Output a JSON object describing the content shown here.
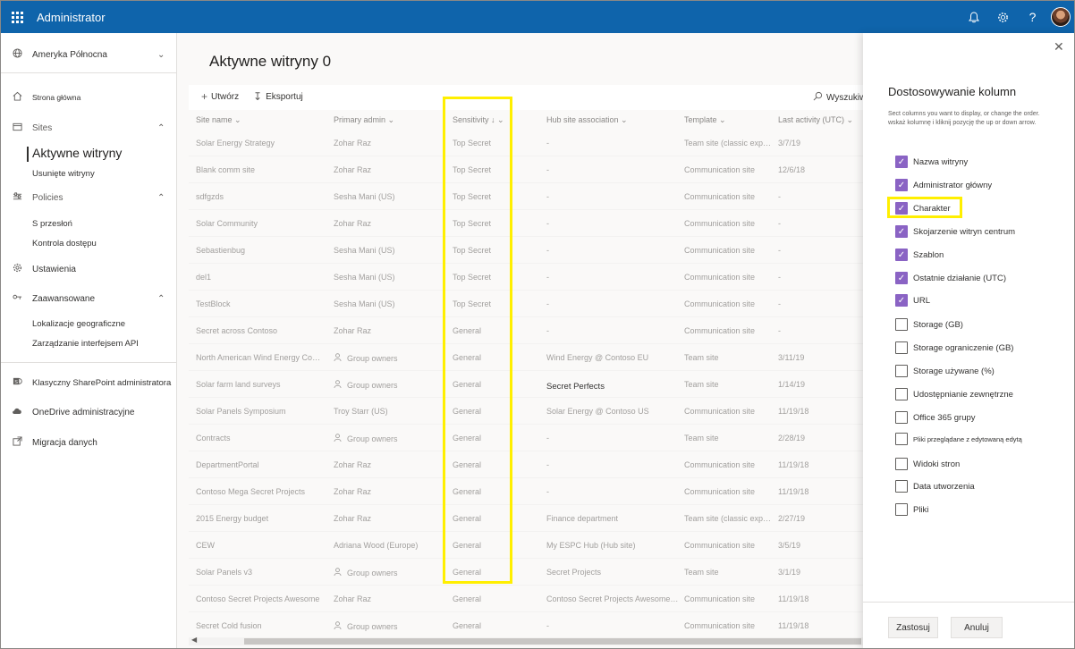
{
  "app": {
    "title": "Administrator"
  },
  "topbar": {
    "icons": [
      "bell-icon",
      "gear-icon",
      "help-icon",
      "avatar"
    ],
    "help_label": "?"
  },
  "nav": {
    "region": "Ameryka Północna",
    "home": "Strona główna",
    "sites": "Sites",
    "active_sites": "Aktywne witryny",
    "deleted_sites": "Usunięte witryny",
    "policies": "Policies",
    "sharing": "S przesłoń",
    "access_control": "Kontrola dostępu",
    "settings": "Ustawienia",
    "advanced": "Zaawansowane",
    "geo": "Lokalizacje geograficzne",
    "api": "Zarządzanie interfejsem API",
    "classic_sp": "Klasyczny SharePoint administratora",
    "onedrive": "OneDrive administracyjne",
    "migration": "Migracja danych"
  },
  "main": {
    "title": "Aktywne witryny 0",
    "create": "Utwórz",
    "export": "Eksportuj",
    "search": "Wyszukiwanie"
  },
  "table": {
    "columns": [
      "Site name",
      "Primary admin",
      "Sensitivity",
      "Hub site association",
      "Template",
      "Last activity (UTC)"
    ],
    "rows": [
      {
        "name": "Solar Energy Strategy",
        "admin": "Zohar Raz",
        "group": false,
        "sens": "Top Secret",
        "hub": "-",
        "hub_dark": false,
        "template": "Team site (classic expe...",
        "last": "3/7/19"
      },
      {
        "name": "Blank comm site",
        "admin": "Zohar Raz",
        "group": false,
        "sens": "Top Secret",
        "hub": "-",
        "hub_dark": false,
        "template": "Communication site",
        "last": "12/6/18"
      },
      {
        "name": "sdfgzds",
        "admin": "Sesha Mani (US)",
        "group": false,
        "sens": "Top Secret",
        "hub": "-",
        "hub_dark": false,
        "template": "Communication site",
        "last": "-"
      },
      {
        "name": "Solar Community",
        "admin": "Zohar Raz",
        "group": false,
        "sens": "Top Secret",
        "hub": "-",
        "hub_dark": false,
        "template": "Communication site",
        "last": "-"
      },
      {
        "name": "Sebastienbug",
        "admin": "Sesha Mani (US)",
        "group": false,
        "sens": "Top Secret",
        "hub": "-",
        "hub_dark": false,
        "template": "Communication site",
        "last": "-"
      },
      {
        "name": "del1",
        "admin": "Sesha Mani (US)",
        "group": false,
        "sens": "Top Secret",
        "hub": "-",
        "hub_dark": false,
        "template": "Communication site",
        "last": "-"
      },
      {
        "name": "TestBlock",
        "admin": "Sesha Mani (US)",
        "group": false,
        "sens": "Top Secret",
        "hub": "-",
        "hub_dark": false,
        "template": "Communication site",
        "last": "-"
      },
      {
        "name": "Secret across Contoso",
        "admin": "Zohar Raz",
        "group": false,
        "sens": "General",
        "hub": "-",
        "hub_dark": false,
        "template": "Communication site",
        "last": "-"
      },
      {
        "name": "North American Wind Energy Confe...",
        "admin": "Group owners",
        "group": true,
        "sens": "General",
        "hub": "Wind Energy @ Contoso EU",
        "hub_dark": false,
        "template": "Team site",
        "last": "3/11/19"
      },
      {
        "name": "Solar farm land surveys",
        "admin": "Group owners",
        "group": true,
        "sens": "General",
        "hub": "Secret Perfects",
        "hub_dark": true,
        "template": "Team site",
        "last": "1/14/19"
      },
      {
        "name": "Solar Panels Symposium",
        "admin": "Troy Starr (US)",
        "group": false,
        "sens": "General",
        "hub": "Solar Energy @ Contoso US",
        "hub_dark": false,
        "template": "Communication site",
        "last": "11/19/18"
      },
      {
        "name": "Contracts",
        "admin": "Group owners",
        "group": true,
        "sens": "General",
        "hub": "-",
        "hub_dark": false,
        "template": "Team site",
        "last": "2/28/19"
      },
      {
        "name": "DepartmentPortal",
        "admin": "Zohar Raz",
        "group": false,
        "sens": "General",
        "hub": "-",
        "hub_dark": false,
        "template": "Communication site",
        "last": "11/19/18"
      },
      {
        "name": "Contoso Mega Secret Projects",
        "admin": "Zohar Raz",
        "group": false,
        "sens": "General",
        "hub": "-",
        "hub_dark": false,
        "template": "Communication site",
        "last": "11/19/18"
      },
      {
        "name": "2015 Energy budget",
        "admin": "Zohar Raz",
        "group": false,
        "sens": "General",
        "hub": "Finance department",
        "hub_dark": false,
        "template": "Team site (classic expe...",
        "last": "2/27/19"
      },
      {
        "name": "CEW",
        "admin": "Adriana Wood (Europe)",
        "group": false,
        "sens": "General",
        "hub": "My ESPC Hub (Hub site)",
        "hub_dark": false,
        "template": "Communication site",
        "last": "3/5/19"
      },
      {
        "name": "Solar Panels v3",
        "admin": "Group owners",
        "group": true,
        "sens": "General",
        "hub": "Secret Projects",
        "hub_dark": false,
        "template": "Team site",
        "last": "3/1/19"
      },
      {
        "name": "Contoso Secret Projects Awesome",
        "admin": "Zohar Raz",
        "group": false,
        "sens": "General",
        "hub": "Contoso Secret Projects Awesome (...",
        "hub_dark": false,
        "template": "Communication site",
        "last": "11/19/18"
      },
      {
        "name": "Secret Cold fusion",
        "admin": "Group owners",
        "group": true,
        "sens": "General",
        "hub": "-",
        "hub_dark": false,
        "template": "Communication site",
        "last": "11/19/18"
      }
    ]
  },
  "panel": {
    "title": "Dostosowywanie kolumn",
    "desc": "Sect columns you want to display, or change the order. wskaż kolumnę i kliknij pozycję the up or down arrow.",
    "options": [
      {
        "label": "Nazwa witryny",
        "checked": true
      },
      {
        "label": "Administrator główny",
        "checked": true
      },
      {
        "label": "Charakter",
        "checked": true
      },
      {
        "label": "Skojarzenie witryn centrum",
        "checked": true
      },
      {
        "label": "Szablon",
        "checked": true
      },
      {
        "label": "Ostatnie działanie (UTC)",
        "checked": true
      },
      {
        "label": "URL",
        "checked": true
      },
      {
        "label": "Storage (GB)",
        "checked": false
      },
      {
        "label": "Storage ograniczenie (GB)",
        "checked": false
      },
      {
        "label": "Storage używane (%)",
        "checked": false
      },
      {
        "label": "Udostępnianie zewnętrzne",
        "checked": false
      },
      {
        "label": "Office 365 grupy",
        "checked": false
      },
      {
        "label": "Pliki przeglądane z edytowaną edytą",
        "checked": false
      },
      {
        "label": "Widoki stron",
        "checked": false
      },
      {
        "label": "Data utworzenia",
        "checked": false
      },
      {
        "label": "Pliki",
        "checked": false
      }
    ],
    "apply": "Zastosuj",
    "cancel": "Anuluj"
  },
  "colors": {
    "topbar": "#0f64ab",
    "checkbox": "#8a63c4",
    "highlight": "#ffef00"
  }
}
